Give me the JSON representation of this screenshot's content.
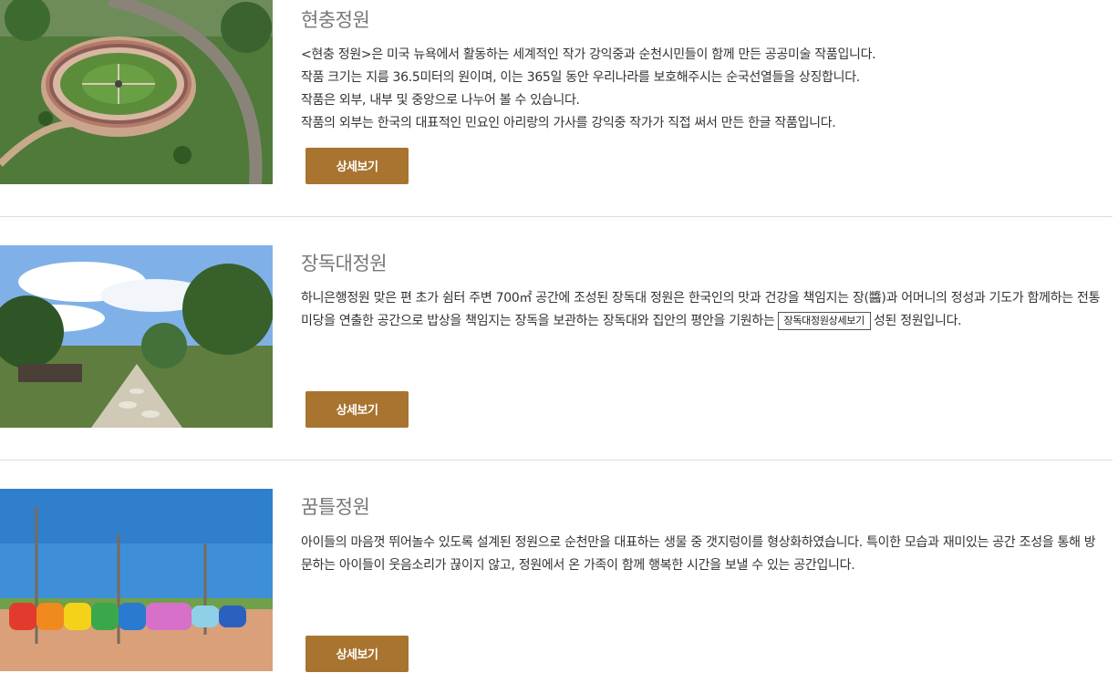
{
  "gardens": [
    {
      "title": "현충정원",
      "lines": [
        "<현충 정원>은 미국 뉴욕에서 활동하는 세계적인 작가 강익중과 순천시민들이 함께 만든 공공미술 작품입니다.",
        " 작품 크기는 지름 36.5미터의 원이며, 이는 365일 동안 우리나라를 보호해주시는 순국선열들을 상징합니다.",
        " 작품은 외부, 내부 및 중앙으로 나누어 볼 수 있습니다.",
        " 작품의 외부는 한국의 대표적인 민요인 아리랑의 가사를 강익중 작가가 직접 써서 만든 한글 작품입니다."
      ],
      "button": "상세보기"
    },
    {
      "title": "장독대정원",
      "text_before": "하니은행정원 맞은 편 초가 쉼터 주변 700㎡ 공간에 조성된 장독대 정원은 한국인의 맛과 건강을 책임지는 장(醬)과 어머니의 정성과 기도가 함께하는 전통 미당을 연출한 공간으로 밥상을 책임지는 장독을 보관하는 장독대와 집안의 평안을 기원하는",
      "tooltip": "장독대정원상세보기",
      "text_after": "성된 정원입니다.",
      "button": "상세보기"
    },
    {
      "title": "꿈틀정원",
      "text": "아이들의 마음껏 뛰어놀수 있도록 설계된 정원으로 순천만을 대표하는 생물 중 갯지렁이를 형상화하였습니다. 특이한 모습과 재미있는 공간 조성을 통해 방문하는 아이들이 웃음소리가 끊이지 않고, 정원에서 온 가족이 함께 행복한 시간을 보낼 수 있는 공간입니다.",
      "button": "상세보기"
    }
  ],
  "colors": {
    "button": "#a8742f",
    "title": "#777777",
    "separator": "#dedede"
  }
}
